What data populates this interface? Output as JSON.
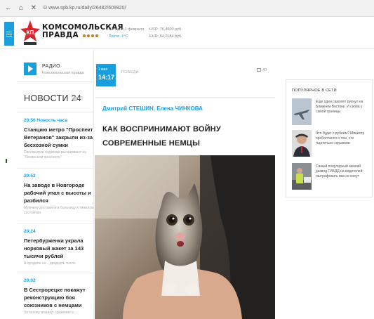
{
  "browser": {
    "url": "D www.spb.kp.ru/daily/26482/609920/"
  },
  "header": {
    "logo_line1": "КОМСОМОЛЬСКАЯ",
    "logo_line2": "ПРАВДА",
    "weather_label": "Сегодня 1 февраля",
    "weather_temp": "Лахта -1°С",
    "rate_usd": "USD: 76,4600 руб.",
    "rate_eur": "EUR: 84,0184 руб."
  },
  "radio": {
    "title": "РАДИО",
    "subtitle": "Комсомольская правда"
  },
  "news": {
    "title": "НОВОСТИ 24",
    "items": [
      {
        "time": "20:56 Новость часа",
        "headline": "Станцию метро \"Проспект Ветеранов\" закрыли из-за бесхозной сумки",
        "sub": "Пассажиров подземки высаживают на \"Ленинском проспекте\""
      },
      {
        "time": "20:52",
        "headline": "На заводе в Новгороде рабочий упал с высоты и разбился",
        "sub": "Мужчину доставили в больницу в тяжелом состоянии"
      },
      {
        "time": "20:24",
        "headline": "Петербурженка украла норковый жакет за 143 тысячи рублей",
        "sub": "А продали ее... двадцать тысяч"
      },
      {
        "time": "20:02",
        "headline": "В Сестрорецке покажут реконструкцию боя союзников с немцами",
        "sub": "За основу возьмут сражение в ..."
      }
    ]
  },
  "article": {
    "date_day": "1 мая",
    "date_time": "14:17",
    "rubric": "ПОБЕДА",
    "comments": "40",
    "authors": "Дмитрий СТЕШИН, Елена ЧИНКОВА",
    "title": "КАК ВОСПРИНИМАЮТ ВОЙНУ СОВРЕМЕННЫЕ НЕМЦЫ"
  },
  "popular": {
    "title": "ПОПУЛЯРНОЕ В СЕТИ",
    "items": [
      {
        "text": "Еще один самолет рухнул на Ближнем Востоке. И снова у самой границы",
        "icon": "fighter-jet"
      },
      {
        "text": "Что будет с рублем? Министр проболтался о том, что тщательно скрывали",
        "icon": "minister-photo"
      },
      {
        "text": "Самый популярный зимний развод ГИБДД на водителей: оштрафовать вас не могут",
        "icon": "traffic-police-photo"
      }
    ]
  },
  "colors": {
    "accent": "#1a9fde",
    "logo_red": "#d8262f"
  }
}
